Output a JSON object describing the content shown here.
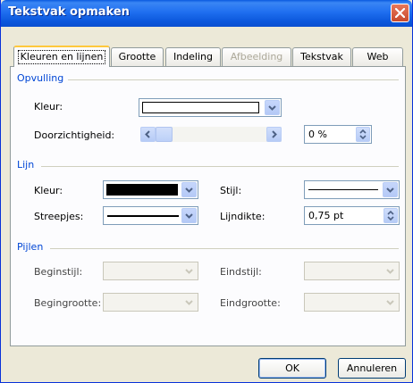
{
  "window": {
    "title": "Tekstvak opmaken"
  },
  "tabs": [
    {
      "label": "Kleuren en lijnen",
      "active": true,
      "enabled": true
    },
    {
      "label": "Grootte",
      "active": false,
      "enabled": true
    },
    {
      "label": "Indeling",
      "active": false,
      "enabled": true
    },
    {
      "label": "Afbeelding",
      "active": false,
      "enabled": false
    },
    {
      "label": "Tekstvak",
      "active": false,
      "enabled": true
    },
    {
      "label": "Web",
      "active": false,
      "enabled": true
    }
  ],
  "fill": {
    "section_label": "Opvulling",
    "color_label": "Kleur:",
    "color_value": "#ffffff",
    "transparency_label": "Doorzichtigheid:",
    "transparency_value": "0 %"
  },
  "line": {
    "section_label": "Lijn",
    "color_label": "Kleur:",
    "color_value": "#000000",
    "dashes_label": "Streepjes:",
    "style_label": "Stijl:",
    "weight_label": "Lijndikte:",
    "weight_value": "0,75 pt"
  },
  "arrows": {
    "section_label": "Pijlen",
    "begin_style_label": "Beginstijl:",
    "begin_size_label": "Begingrootte:",
    "end_style_label": "Eindstijl:",
    "end_size_label": "Eindgrootte:"
  },
  "buttons": {
    "ok": "OK",
    "cancel": "Annuleren"
  },
  "colors": {
    "titlebar": "#0a5ae0",
    "accent": "#0046d5",
    "tab_highlight": "#ffc83c"
  },
  "icons": [
    "close-icon",
    "chevron-down-icon",
    "scroll-left-icon",
    "scroll-right-icon",
    "spin-up-down-icon"
  ]
}
